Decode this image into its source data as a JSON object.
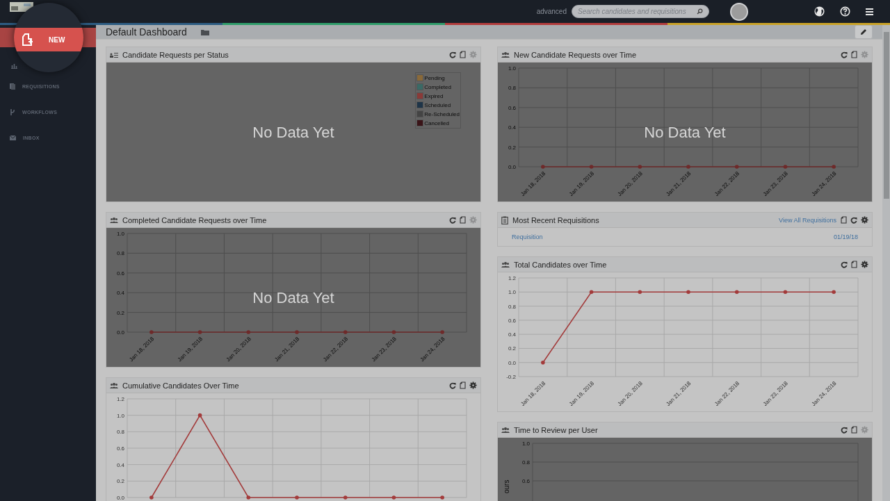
{
  "topbar": {
    "mode_label": "advanced",
    "search": {
      "placeholder": "Search candidates and requisitions"
    }
  },
  "new_button": {
    "label": "NEW"
  },
  "sidebar": {
    "items": [
      {
        "label": "REQUISITIONS",
        "kind": "requisitions"
      },
      {
        "label": "WORKFLOWS",
        "kind": "workflows"
      },
      {
        "label": "INBOX",
        "kind": "inbox"
      }
    ]
  },
  "dashboard": {
    "title": "Default Dashboard"
  },
  "columns": [
    [
      {
        "kind": "status-chart",
        "title": "Candidate Requests per Status",
        "settings_enabled": false,
        "overlay_text": "No Data Yet",
        "legend": [
          {
            "label": "Pending",
            "color": "#8a6a3a"
          },
          {
            "label": "Completed",
            "color": "#3a6a66"
          },
          {
            "label": "Expired",
            "color": "#8a3a38"
          },
          {
            "label": "Scheduled",
            "color": "#1e3448"
          },
          {
            "label": "Re-Scheduled",
            "color": "#444444"
          },
          {
            "label": "Cancelled",
            "color": "#3a1418"
          }
        ]
      },
      {
        "kind": "chart",
        "title": "Completed Candidate Requests over Time",
        "settings_enabled": false,
        "overlay_text": "No Data Yet",
        "chart_data": {
          "type": "line",
          "grid": true,
          "categories": [
            "Jan 18, 2018",
            "Jan 19, 2018",
            "Jan 20, 2018",
            "Jan 21, 2018",
            "Jan 22, 2018",
            "Jan 23, 2018",
            "Jan 24, 2018"
          ],
          "series": [
            {
              "color": "#6e2a2a",
              "values": [
                0,
                0,
                0,
                0,
                0,
                0,
                0
              ]
            }
          ],
          "ylim": [
            0,
            1
          ],
          "yticks": [
            {
              "value": 0,
              "label": "0.0"
            },
            {
              "value": 0.2,
              "label": "0.2"
            },
            {
              "value": 0.4,
              "label": "0.4"
            },
            {
              "value": 0.6,
              "label": "0.6"
            },
            {
              "value": 0.8,
              "label": "0.8"
            },
            {
              "value": 1,
              "label": "1.0"
            }
          ]
        }
      },
      {
        "kind": "chart",
        "title": "Cumulative Candidates Over Time",
        "settings_enabled": true,
        "chart_data": {
          "type": "line",
          "grid": true,
          "series": [
            {
              "color": "#a33b3b",
              "values": [
                0,
                1,
                0,
                0,
                0,
                0,
                0
              ]
            }
          ],
          "ylim": [
            0,
            1.2
          ],
          "yticks": [
            {
              "value": 0,
              "label": "0.0"
            },
            {
              "value": 0.2,
              "label": "0.2"
            },
            {
              "value": 0.4,
              "label": "0.4"
            },
            {
              "value": 0.6,
              "label": "0.6"
            },
            {
              "value": 0.8,
              "label": "0.8"
            },
            {
              "value": 1,
              "label": "1.0"
            },
            {
              "value": 1.2,
              "label": "1.2"
            }
          ]
        }
      }
    ],
    [
      {
        "kind": "chart",
        "title": "New Candidate Requests over Time",
        "settings_enabled": false,
        "overlay_text": "No Data Yet",
        "chart_data": {
          "type": "line",
          "grid": true,
          "categories": [
            "Jan 18, 2018",
            "Jan 19, 2018",
            "Jan 20, 2018",
            "Jan 21, 2018",
            "Jan 22, 2018",
            "Jan 23, 2018",
            "Jan 24, 2018"
          ],
          "series": [
            {
              "color": "#6e2a2a",
              "values": [
                0,
                0,
                0,
                0,
                0,
                0,
                0
              ]
            }
          ],
          "ylim": [
            0,
            1
          ],
          "yticks": [
            {
              "value": 0,
              "label": "0.0"
            },
            {
              "value": 0.2,
              "label": "0.2"
            },
            {
              "value": 0.4,
              "label": "0.4"
            },
            {
              "value": 0.6,
              "label": "0.6"
            },
            {
              "value": 0.8,
              "label": "0.8"
            },
            {
              "value": 1,
              "label": "1.0"
            }
          ]
        }
      },
      {
        "kind": "list",
        "title": "Most Recent Requisitions",
        "settings_enabled": true,
        "link": "View All Requisitions",
        "rows": [
          {
            "name": "Requisition",
            "date": "01/19/18"
          }
        ]
      },
      {
        "kind": "chart",
        "title": "Total Candidates over Time",
        "settings_enabled": true,
        "chart_data": {
          "type": "line",
          "grid": true,
          "categories": [
            "Jan 18, 2018",
            "Jan 19, 2018",
            "Jan 20, 2018",
            "Jan 21, 2018",
            "Jan 22, 2018",
            "Jan 23, 2018",
            "Jan 24, 2018"
          ],
          "series": [
            {
              "color": "#a33b3b",
              "values": [
                0,
                1,
                1,
                1,
                1,
                1,
                1
              ]
            }
          ],
          "ylim": [
            -0.2,
            1.2
          ],
          "yticks": [
            {
              "value": -0.2,
              "label": "-0.2"
            },
            {
              "value": 0,
              "label": "0.0"
            },
            {
              "value": 0.2,
              "label": "0.2"
            },
            {
              "value": 0.4,
              "label": "0.4"
            },
            {
              "value": 0.6,
              "label": "0.6"
            },
            {
              "value": 0.8,
              "label": "0.8"
            },
            {
              "value": 1,
              "label": "1.0"
            },
            {
              "value": 1.2,
              "label": "1.2"
            }
          ]
        }
      },
      {
        "kind": "empty-chart",
        "title": "Time to Review per User",
        "settings_enabled": false,
        "y_labels": [
          "1.0",
          "0.8",
          "0.6"
        ],
        "axis_title": "ours"
      }
    ]
  ]
}
